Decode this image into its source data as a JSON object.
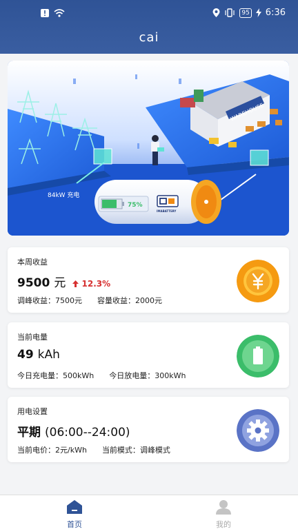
{
  "status": {
    "battery": "95",
    "time": "6:36"
  },
  "header": {
    "title": "cai"
  },
  "banner": {
    "battery_percent": 75,
    "battery_label": "75%",
    "charge_label": "84kW 充电",
    "warehouse_sign": "WAREHOUSE",
    "brand_text": "IMABATTERY"
  },
  "cards": {
    "earnings": {
      "label": "本周收益",
      "value": "9500",
      "unit": "元",
      "delta": "12.3%",
      "sub1": "调峰收益：7500元",
      "sub2": "容量收益：2000元"
    },
    "power": {
      "label": "当前电量",
      "value": "49",
      "unit": "kAh",
      "sub1": "今日充电量：500kWh",
      "sub2": "今日放电量：300kWh"
    },
    "settings": {
      "label": "用电设置",
      "value": "平期",
      "unit": "(06:00--24:00)",
      "sub1": "当前电价：2元/kWh",
      "sub2": "当前模式：调峰模式"
    }
  },
  "nav": {
    "home": "首页",
    "mine": "我的"
  },
  "colors": {
    "header": "#2f5396",
    "accent_red": "#d63030",
    "coin": "#f59a11",
    "battery_green": "#3bbd6a",
    "gear_blue": "#5a73c6"
  }
}
